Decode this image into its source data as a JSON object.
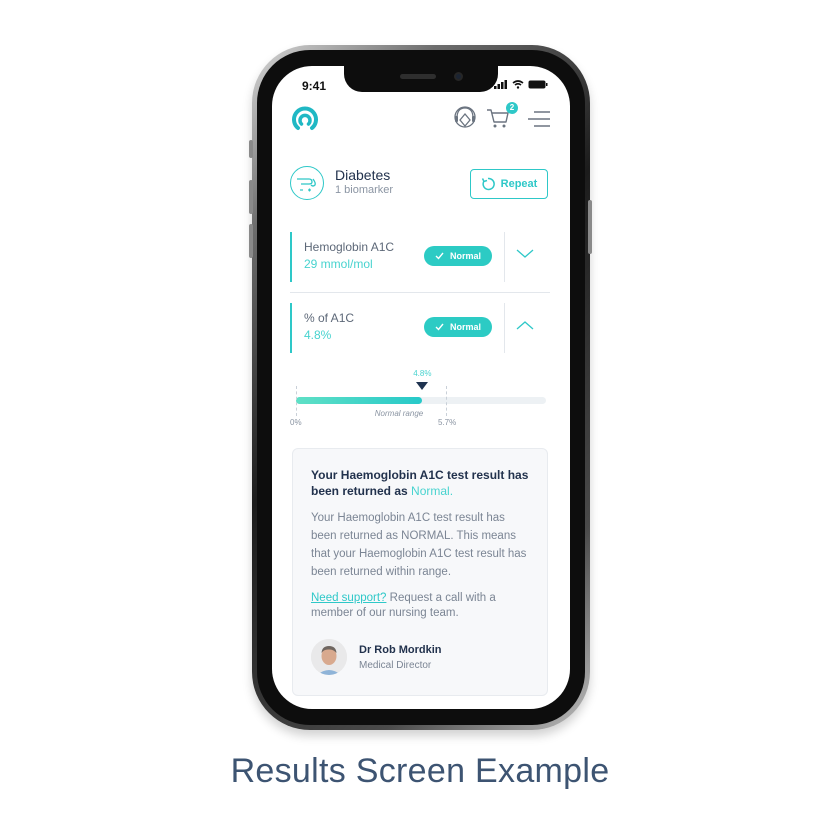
{
  "status_bar": {
    "time": "9:41"
  },
  "header": {
    "logo_icon": "app-logo-icon",
    "support_icon": "support-agent-icon",
    "cart_icon": "cart-icon",
    "cart_badge": "2",
    "menu_icon": "menu-icon"
  },
  "test": {
    "title": "Diabetes",
    "subtitle": "1 biomarker",
    "repeat_label": "Repeat"
  },
  "biomarkers": [
    {
      "name": "Hemoglobin A1C",
      "value": "29 mmol/mol",
      "status": "Normal",
      "expanded": false
    },
    {
      "name": "% of A1C",
      "value": "4.8%",
      "status": "Normal",
      "expanded": true
    }
  ],
  "range": {
    "value": 4.8,
    "value_label": "4.8%",
    "min_label": "0%",
    "upper_label": "5.7%",
    "upper": 5.7,
    "scale_max": 9.5,
    "caption": "Normal range"
  },
  "result_card": {
    "title_prefix": "Your Haemoglobin A1C test result has been returned as ",
    "title_status": "Normal.",
    "body": "Your Haemoglobin A1C test result has been returned as NORMAL. This means that your Haemoglobin A1C test result has been returned within range.",
    "support_link": "Need support?",
    "support_text": " Request a call with a member of our nursing team.",
    "doctor_name": "Dr Rob Mordkin",
    "doctor_role": "Medical Director"
  },
  "caption": "Results Screen Example",
  "colors": {
    "accent": "#2ec8c8",
    "navy": "#22324d",
    "caption": "#3d5472"
  }
}
